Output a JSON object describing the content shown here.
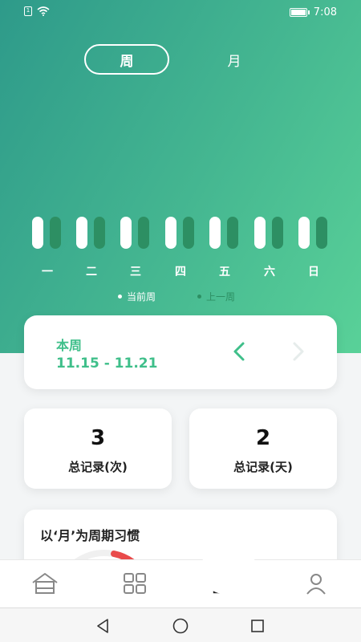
{
  "status_bar": {
    "time": "7:08",
    "sim_label": "1"
  },
  "period_tabs": {
    "week": "周",
    "month": "月",
    "selected": "week"
  },
  "weekly_bars": {
    "days": [
      "一",
      "二",
      "三",
      "四",
      "五",
      "六",
      "日"
    ],
    "legend": {
      "current": "当前周",
      "previous": "上一周"
    },
    "colors": {
      "current": "#ffffff",
      "previous": "#2d8f63"
    }
  },
  "week_card": {
    "title": "本周",
    "range": "11.15 - 11.21"
  },
  "stats": {
    "total_times_value": "3",
    "total_times_label": "总记录(次)",
    "total_days_value": "2",
    "total_days_label": "总记录(天)"
  },
  "habit_card": {
    "title": "以‘月’为周期习惯"
  },
  "bottom_nav": {
    "items": [
      "home-icon",
      "grid-icon",
      "chart-icon",
      "user-icon"
    ],
    "active": "chart-icon"
  },
  "theme": {
    "accent": "#3fbf8a",
    "gradient_start": "#2e9a8a",
    "gradient_end": "#59d198",
    "arc_red": "#e94b4b"
  }
}
